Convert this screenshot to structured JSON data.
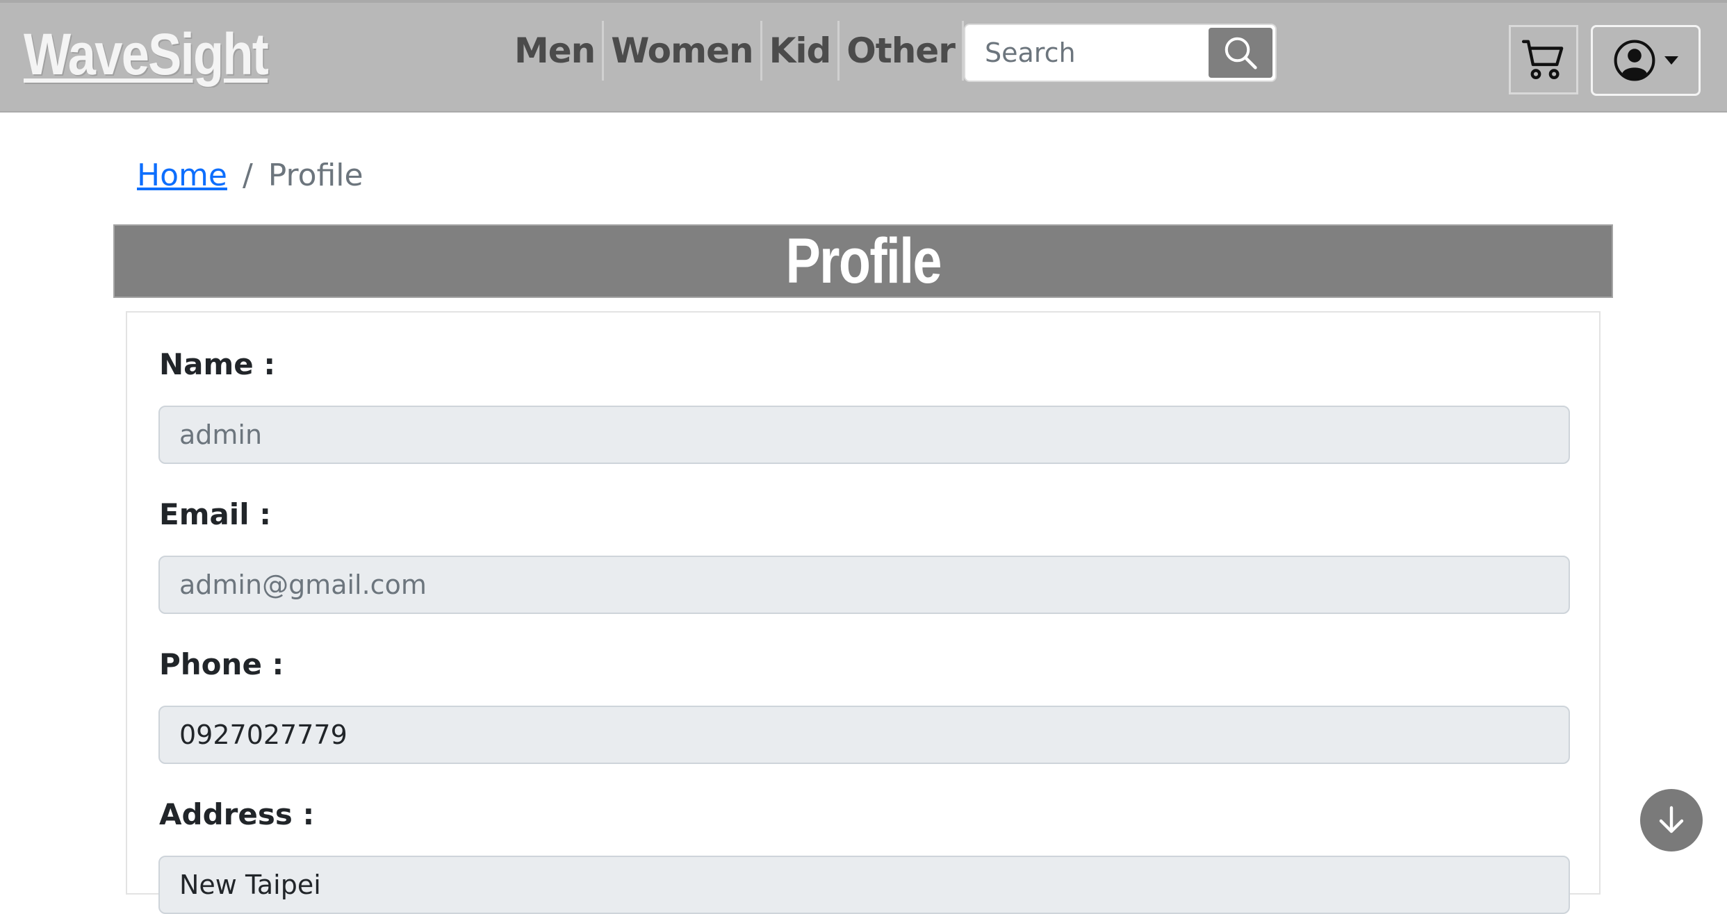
{
  "header": {
    "brand": "WaveSight",
    "nav": [
      "Men",
      "Women",
      "Kid",
      "Other"
    ],
    "search_placeholder": "Search"
  },
  "icons": {
    "search": "search-icon",
    "cart": "cart-icon",
    "user": "user-circle-icon",
    "caret": "caret-down-icon",
    "scroll": "arrow-down-icon"
  },
  "breadcrumb": {
    "home": "Home",
    "separator": "/",
    "current": "Profile"
  },
  "page_title": "Profile",
  "form": {
    "name_label": "Name :",
    "name_value": "admin",
    "email_label": "Email :",
    "email_value": "admin@gmail.com",
    "phone_label": "Phone :",
    "phone_value": "0927027779",
    "address_label": "Address :",
    "address_value": "New Taipei"
  },
  "colors": {
    "header_bg": "#b8b8b8",
    "title_bar_bg": "#808080",
    "link": "#0d6efd",
    "input_bg": "#e9ecef"
  }
}
